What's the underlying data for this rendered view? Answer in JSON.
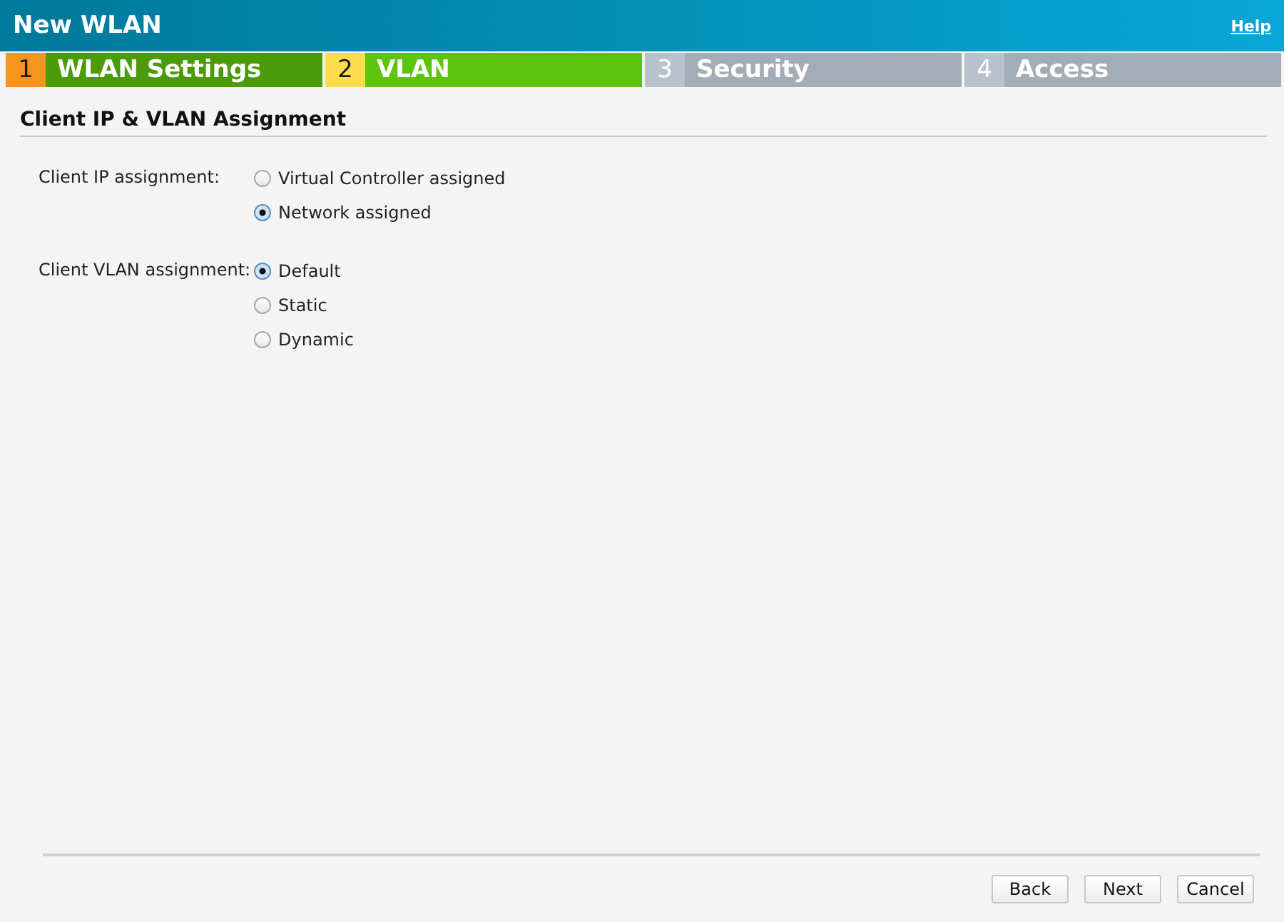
{
  "window": {
    "title": "New WLAN",
    "help_link": "Help"
  },
  "steps": [
    {
      "number": "1",
      "label": "WLAN Settings",
      "kind": "done"
    },
    {
      "number": "2",
      "label": "VLAN",
      "kind": "current"
    },
    {
      "number": "3",
      "label": "Security",
      "kind": "pending"
    },
    {
      "number": "4",
      "label": "Access",
      "kind": "pending"
    }
  ],
  "section_title": "Client IP & VLAN Assignment",
  "groups": [
    {
      "label": "Client IP assignment:",
      "options": [
        {
          "label": "Virtual Controller assigned",
          "selected": false
        },
        {
          "label": "Network assigned",
          "selected": true
        }
      ]
    },
    {
      "label": "Client VLAN assignment:",
      "options": [
        {
          "label": "Default",
          "selected": true
        },
        {
          "label": "Static",
          "selected": false
        },
        {
          "label": "Dynamic",
          "selected": false
        }
      ]
    }
  ],
  "buttons": [
    "Back",
    "Next",
    "Cancel"
  ]
}
